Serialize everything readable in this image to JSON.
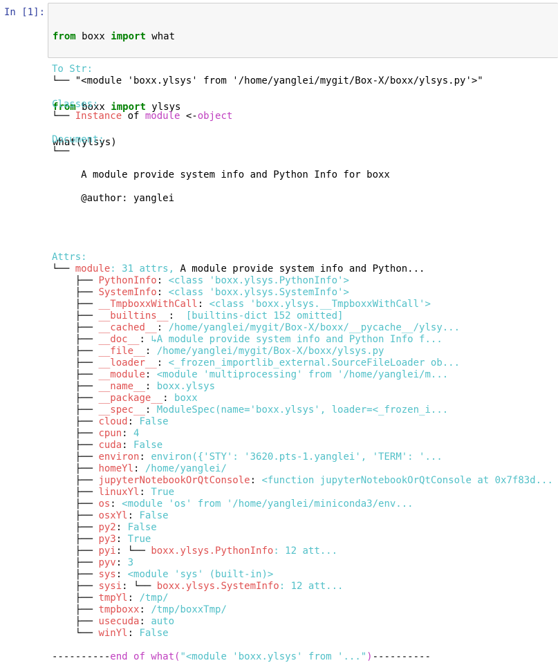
{
  "prompt": "In [1]:",
  "code": {
    "line1": {
      "kw1": "from",
      "mod": " boxx ",
      "kw2": "import",
      "name": " what"
    },
    "line2": {
      "kw1": "from",
      "mod": " boxx ",
      "kw2": "import",
      "name": " ylsys"
    },
    "line3": "what(ylsys)"
  },
  "output": {
    "to_str_header": "To Str:",
    "to_str_value": "└── \"<module 'boxx.ylsys' from '/home/yanglei/mygit/Box-X/boxx/ylsys.py'>\"",
    "classes_header": "Classes:",
    "classes_branch": "└── ",
    "classes_instance": "Instance",
    "classes_of": " of ",
    "classes_module": "module",
    "classes_arrow": " <-",
    "classes_object": "object",
    "document_header": "Document:",
    "document_branch": "└──",
    "document_line1": "     A module provide system info and Python Info for boxx",
    "document_line2": "     @author: yanglei",
    "attrs_header": "Attrs:",
    "attrs_root_branch": "└── ",
    "attrs_root_name": "module",
    "attrs_root_count": ": 31 attrs, ",
    "attrs_root_desc": "A module provide system info and Python...",
    "attrs": [
      {
        "name": "PythonInfo",
        "value": "<class 'boxx.ylsys.PythonInfo'>"
      },
      {
        "name": "SystemInfo",
        "value": "<class 'boxx.ylsys.SystemInfo'>"
      },
      {
        "name": "__TmpboxxWithCall",
        "value": "<class 'boxx.ylsys.__TmpboxxWithCall'>"
      },
      {
        "name": "__builtins__",
        "value": " [builtins-dict 152 omitted]"
      },
      {
        "name": "__cached__",
        "value": "/home/yanglei/mygit/Box-X/boxx/__pycache__/ylsy..."
      },
      {
        "name": "__doc__",
        "value": "↳A module provide system info and Python Info f..."
      },
      {
        "name": "__file__",
        "value": "/home/yanglei/mygit/Box-X/boxx/ylsys.py"
      },
      {
        "name": "__loader__",
        "value": "<_frozen_importlib_external.SourceFileLoader ob..."
      },
      {
        "name": "__module",
        "value": "<module 'multiprocessing' from '/home/yanglei/m..."
      },
      {
        "name": "__name__",
        "value": "boxx.ylsys"
      },
      {
        "name": "__package__",
        "value": "boxx"
      },
      {
        "name": "__spec__",
        "value": "ModuleSpec(name='boxx.ylsys', loader=<_frozen_i..."
      },
      {
        "name": "cloud",
        "value": "False"
      },
      {
        "name": "cpun",
        "value": "4"
      },
      {
        "name": "cuda",
        "value": "False"
      },
      {
        "name": "environ",
        "value": "environ({'STY': '3620.pts-1.yanglei', 'TERM': '..."
      },
      {
        "name": "homeYl",
        "value": "/home/yanglei/"
      },
      {
        "name": "jupyterNotebookOrQtConsole",
        "value": "<function jupyterNotebookOrQtConsole at 0x7f83d..."
      },
      {
        "name": "linuxYl",
        "value": "True"
      },
      {
        "name": "os",
        "value": "<module 'os' from '/home/yanglei/miniconda3/env..."
      },
      {
        "name": "osxYl",
        "value": "False"
      },
      {
        "name": "py2",
        "value": "False"
      },
      {
        "name": "py3",
        "value": "True"
      },
      {
        "name": "pyi",
        "value": "",
        "subtree": {
          "branch": "└── ",
          "name": "boxx.ylsys.PythonInfo",
          "count": ": 12 att..."
        }
      },
      {
        "name": "pyv",
        "value": "3"
      },
      {
        "name": "sys",
        "value": "<module 'sys' (built-in)>"
      },
      {
        "name": "sysi",
        "value": "",
        "subtree": {
          "branch": "└── ",
          "name": "boxx.ylsys.SystemInfo",
          "count": ": 12 att..."
        }
      },
      {
        "name": "tmpYl",
        "value": "/tmp/"
      },
      {
        "name": "tmpboxx",
        "value": "/tmp/boxxTmp/"
      },
      {
        "name": "usecuda",
        "value": "auto"
      },
      {
        "name": "winYl",
        "value": "False"
      }
    ],
    "footer_dashes_left": "----------",
    "footer_text": "end of what(",
    "footer_arg": "\"<module 'boxx.ylsys' from '...\"",
    "footer_close": ")",
    "footer_dashes_right": "----------"
  }
}
